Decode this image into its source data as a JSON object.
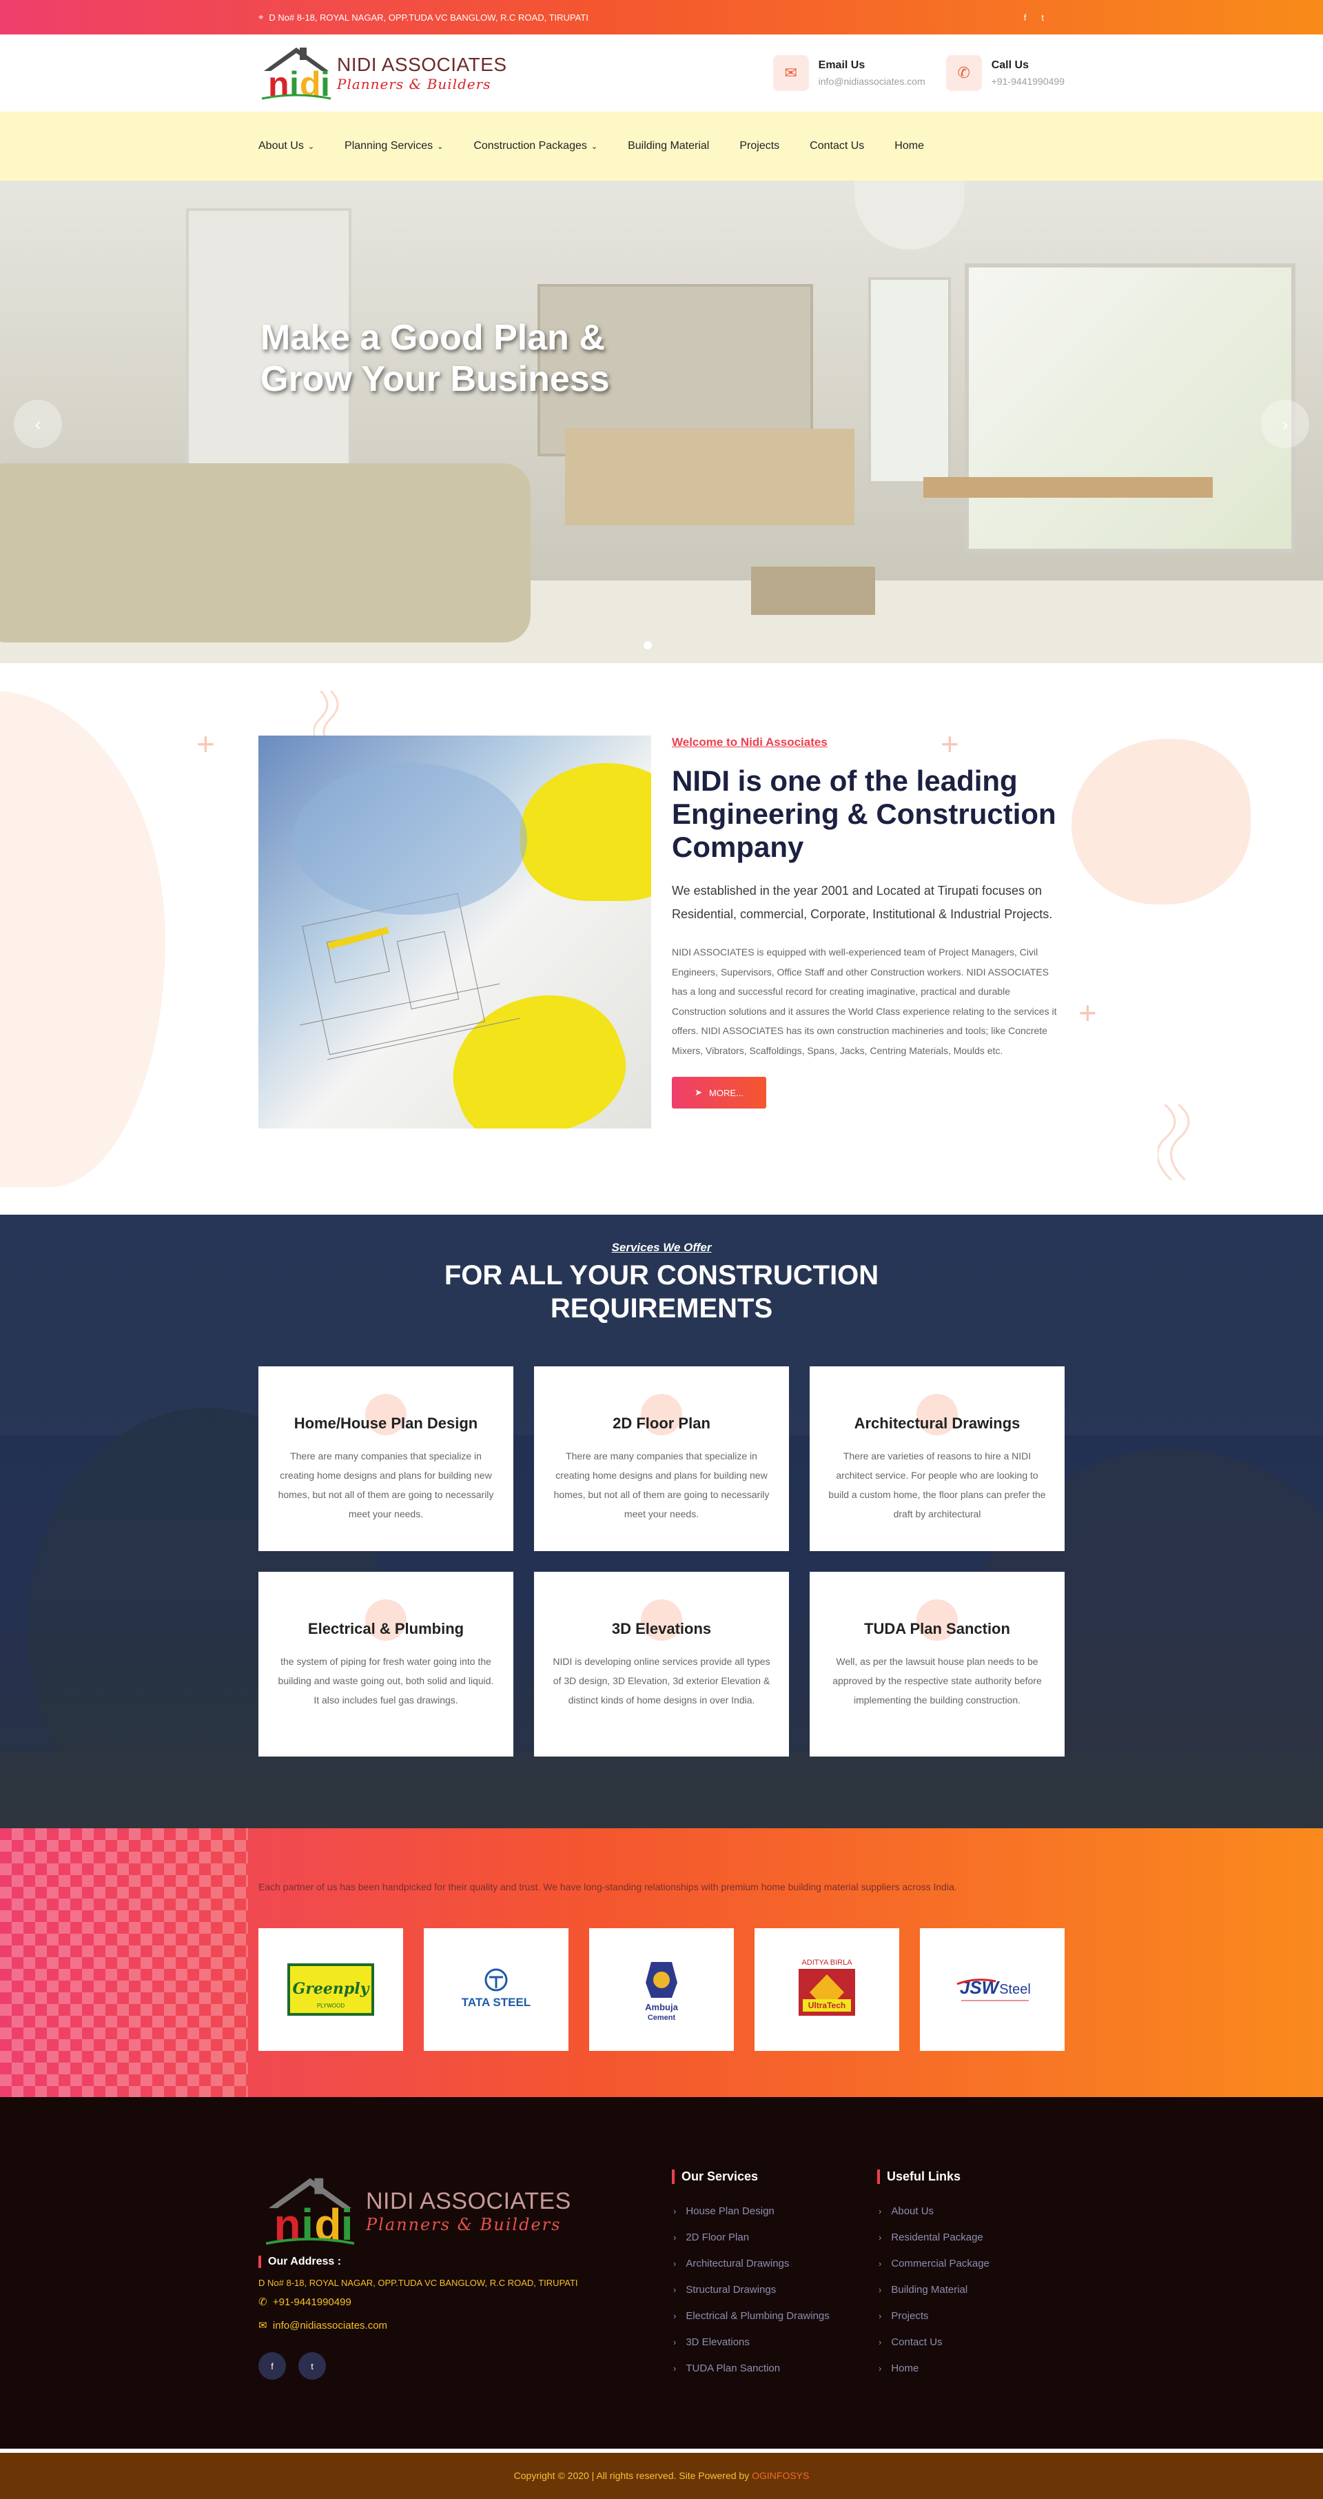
{
  "topbar": {
    "address": "D No# 8-18, ROYAL NAGAR, OPP.TUDA VC BANGLOW, R.C ROAD, TIRUPATI",
    "social": [
      "f",
      "t"
    ]
  },
  "header": {
    "logo_main": "NIDI ASSOCIATES",
    "logo_sub": "Planners & Builders",
    "email_label": "Email Us",
    "email_value": "info@nidiassociates.com",
    "call_label": "Call Us",
    "call_value": "+91-9441990499"
  },
  "nav": {
    "items": [
      "About Us",
      "Planning Services",
      "Construction Packages",
      "Building Material",
      "Projects",
      "Contact Us",
      "Home"
    ]
  },
  "hero": {
    "heading_line1": "Make a Good Plan &",
    "heading_line2": "Grow Your Business"
  },
  "about": {
    "welcome": "Welcome to Nidi Associates",
    "heading": "NIDI is one of the leading Engineering & Construction Company",
    "lead": "We established in the year 2001 and Located at Tirupati focuses on Residential, commercial, Corporate, Institutional & Industrial Projects.",
    "body": "NIDI ASSOCIATES is equipped with well-experienced team of Project Managers, Civil Engineers, Supervisors, Office Staff and other Construction workers. NIDI ASSOCIATES has a long and successful record for creating imaginative, practical and durable Construction solutions and it assures the World Class experience relating to the services it offers. NIDI ASSOCIATES has its own construction machineries and tools; like Concrete Mixers, Vibrators, Scaffoldings, Spans, Jacks, Centring Materials, Moulds etc.",
    "more_button": "MORE..."
  },
  "services": {
    "subtitle": "Services We Offer",
    "title_line1": "FOR ALL YOUR CONSTRUCTION",
    "title_line2": "REQUIREMENTS",
    "cards": [
      {
        "title": "Home/House Plan Design",
        "text": "There are many companies that specialize in creating home designs and plans for building new homes, but not all of them are going to necessarily meet your needs."
      },
      {
        "title": "2D Floor Plan",
        "text": "There are many companies that specialize in creating home designs and plans for building new homes, but not all of them are going to necessarily meet your needs."
      },
      {
        "title": "Architectural Drawings",
        "text": "There are varieties of reasons to hire a NIDI architect service. For people who are looking to build a custom home, the floor plans can prefer the draft by architectural"
      },
      {
        "title": "Electrical & Plumbing",
        "text": "the system of piping for fresh water going into the building and waste going out, both solid and liquid. It also includes fuel gas drawings."
      },
      {
        "title": "3D Elevations",
        "text": "NIDI is developing online services provide all types of 3D design, 3D Elevation, 3d exterior Elevation & distinct kinds of home designs in over India."
      },
      {
        "title": "TUDA Plan Sanction",
        "text": "Well, as per the lawsuit house plan needs to be approved by the respective state authority before implementing the building construction."
      }
    ]
  },
  "partners": {
    "text": "Each partner of us has been handpicked for their quality and trust. We have long-standing relationships with premium home building material suppliers across India.",
    "logos": [
      {
        "name": "Greenply",
        "sub": "PLYWOOD"
      },
      {
        "name": "TATA STEEL"
      },
      {
        "name": "Ambuja",
        "sub": "Cement"
      },
      {
        "name": "ADITYA BIRLA",
        "sub": "UltraTech"
      },
      {
        "name": "JSW",
        "sub": "Steel"
      }
    ]
  },
  "footer": {
    "logo_main": "NIDI ASSOCIATES",
    "logo_sub": "Planners & Builders",
    "address_heading": "Our Address :",
    "address": "D No# 8-18, ROYAL NAGAR, OPP.TUDA VC BANGLOW, R.C ROAD, TIRUPATI",
    "phone": "+91-9441990499",
    "email": "info@nidiassociates.com",
    "services_heading": "Our Services",
    "services": [
      "House Plan Design",
      "2D Floor Plan",
      "Architectural Drawings",
      "Structural Drawings",
      "Electrical & Plumbing Drawings",
      "3D Elevations",
      "TUDA Plan Sanction"
    ],
    "links_heading": "Useful Links",
    "links": [
      "About Us",
      "Residental Package",
      "Commercial Package",
      "Building Material",
      "Projects",
      "Contact Us",
      "Home"
    ]
  },
  "copyright": {
    "text": "Copyright © 2020 | All rights reserved. Site Powered by",
    "powered": "OGINFOSYS"
  },
  "colors": {
    "accent": "#ee3f4d",
    "orange": "#f98b1a",
    "nav_bg": "#fdf8c6",
    "dark_navy": "#1c2041",
    "footer_bg": "#150807"
  }
}
